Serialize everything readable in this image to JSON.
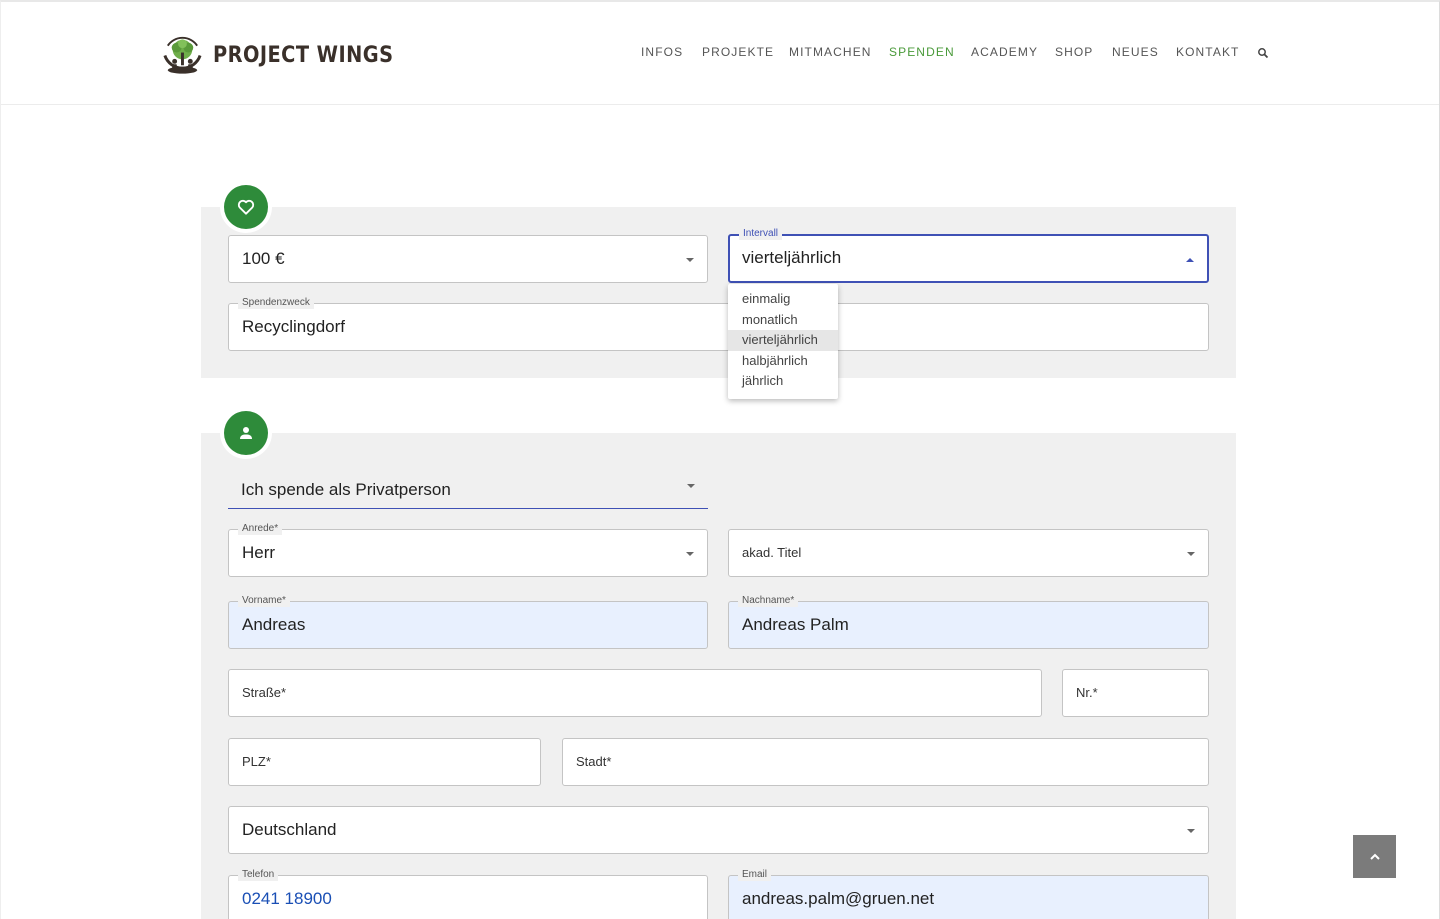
{
  "brand": {
    "name": "PROJECT WINGS"
  },
  "nav": {
    "items": [
      {
        "label": "INFOS",
        "active": false
      },
      {
        "label": "PROJEKTE",
        "active": false
      },
      {
        "label": "MITMACHEN",
        "active": false
      },
      {
        "label": "SPENDEN",
        "active": true
      },
      {
        "label": "ACADEMY",
        "active": false
      },
      {
        "label": "SHOP",
        "active": false
      },
      {
        "label": "NEUES",
        "active": false
      },
      {
        "label": "KONTAKT",
        "active": false
      }
    ],
    "search_icon": "search-icon"
  },
  "colors": {
    "accent_green": "#2e8b3a",
    "focus_blue": "#3f51b5",
    "nav_active": "#4a9a3a",
    "autofill_bg": "#e8f0fe"
  },
  "donation": {
    "section_icon": "heart-icon",
    "amount": {
      "value": "100 €"
    },
    "interval": {
      "label": "Intervall",
      "value": "vierteljährlich",
      "options": [
        "einmalig",
        "monatlich",
        "vierteljährlich",
        "halbjährlich",
        "jährlich"
      ],
      "selected_index": 2
    },
    "purpose": {
      "label": "Spendenzweck",
      "value": "Recyclingdorf"
    }
  },
  "person": {
    "section_icon": "person-icon",
    "donor_type": {
      "value": "Ich spende als Privatperson"
    },
    "salutation": {
      "label": "Anrede*",
      "value": "Herr"
    },
    "title": {
      "placeholder": "akad. Titel"
    },
    "firstname": {
      "label": "Vorname*",
      "value": "Andreas"
    },
    "lastname": {
      "label": "Nachname*",
      "value": "Andreas Palm"
    },
    "street": {
      "placeholder": "Straße*"
    },
    "number": {
      "placeholder": "Nr.*"
    },
    "zip": {
      "placeholder": "PLZ*"
    },
    "city": {
      "placeholder": "Stadt*"
    },
    "country": {
      "value": "Deutschland"
    },
    "phone": {
      "label": "Telefon",
      "value": "0241 18900"
    },
    "email": {
      "label": "Email",
      "value": "andreas.palm@gruen.net"
    }
  },
  "scroll_top_icon": "chevron-up-icon"
}
